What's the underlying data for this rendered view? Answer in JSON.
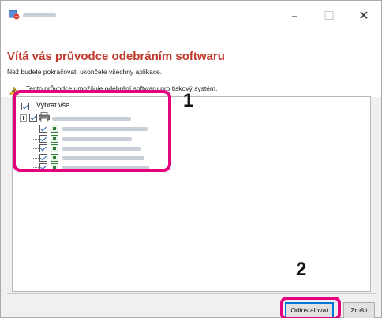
{
  "window": {
    "title": "",
    "controls": {
      "minimize": "–",
      "maximize": "☐",
      "close": "✕"
    }
  },
  "header": {
    "title": "Vítá vás průvodce odebráním softwaru",
    "subtitle": "Než budete pokračovat, ukončete všechny aplikace.",
    "warning_text": "Tento průvodce umožňuje odebrání softwaru pro tiskový systém."
  },
  "list": {
    "select_all_label": "Vybrat vše",
    "select_all_checked": true,
    "root_checked": true,
    "items": [
      {
        "checked": true
      },
      {
        "checked": true
      },
      {
        "checked": true
      },
      {
        "checked": true
      },
      {
        "checked": true
      }
    ]
  },
  "callouts": {
    "one": "1",
    "two": "2"
  },
  "buttons": {
    "uninstall": "Odinstalovat",
    "cancel": "Zrušit"
  },
  "colors": {
    "title": "#c0392b",
    "highlight": "#e4007f",
    "focus_border": "#0078d7"
  },
  "icons": [
    "uninstall-app-icon",
    "warning-icon",
    "printer-icon",
    "device-icon"
  ]
}
